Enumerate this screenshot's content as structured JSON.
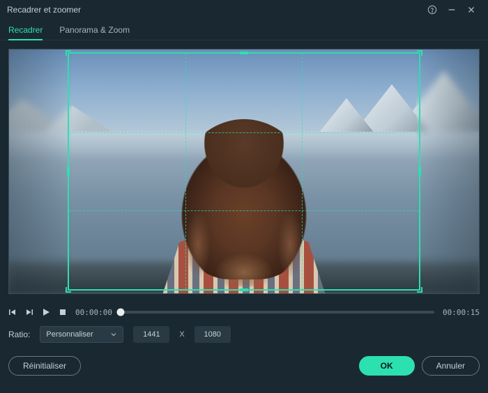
{
  "window": {
    "title": "Recadrer et zoomer"
  },
  "tabs": {
    "crop": "Recadrer",
    "panzoom": "Panorama & Zoom"
  },
  "playback": {
    "current_time": "00:00:00",
    "total_time": "00:00:15"
  },
  "ratio": {
    "label": "Ratio:",
    "selected": "Personnaliser",
    "width": "1441",
    "separator": "X",
    "height": "1080"
  },
  "footer": {
    "reset": "Réinitialiser",
    "ok": "OK",
    "cancel": "Annuler"
  },
  "crop_grid": {
    "rows": 3,
    "cols": 3
  },
  "colors": {
    "accent": "#2de0b0",
    "bg": "#1a2832"
  }
}
